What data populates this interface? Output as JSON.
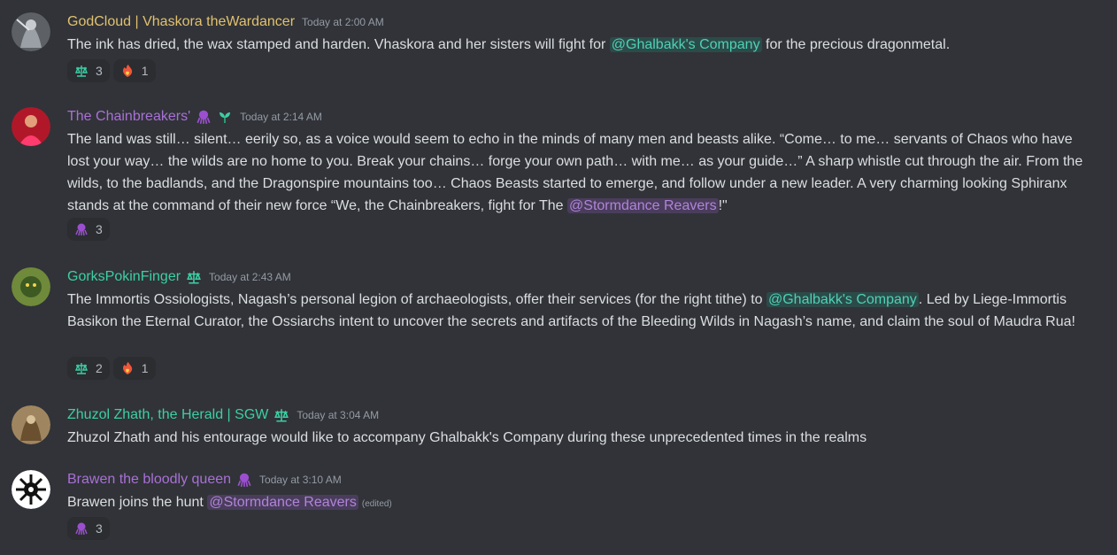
{
  "colors": {
    "background": "#313338",
    "gold": "#e1c16e",
    "purple": "#a970d6",
    "teal": "#3ccfa5"
  },
  "messages": [
    {
      "author": "GodCloud | Vhaskora theWardancer",
      "timestamp": "Today at 2:00 AM",
      "text_before": "The ink has dried, the wax stamped and harden. Vhaskora and her sisters will fight for ",
      "mention": "@Ghalbakk's Company",
      "text_after": " for the precious dragonmetal.",
      "reactions": [
        {
          "emoji": "scale-icon",
          "count": "3"
        },
        {
          "emoji": "fire-heart-icon",
          "count": "1"
        }
      ]
    },
    {
      "author": "The Chainbreakers'",
      "timestamp": "Today at 2:14 AM",
      "text_before": "The land was still… silent… eerily so, as a voice would seem to echo in the minds of many men and beasts alike. “Come… to me… servants of Chaos who have lost your way… the wilds are no home to you. Break your chains… forge your own path… with me… as your guide…” A sharp whistle cut through the air. From the wilds, to the badlands, and the Dragonspire mountains too… Chaos Beasts started to emerge, and follow under a new leader. A very charming looking Sphiranx stands at the command of their new force “We, the Chainbreakers, fight for The ",
      "mention": "@Stormdance Reavers",
      "text_after": "!\"",
      "reactions": [
        {
          "emoji": "octopus-icon",
          "count": "3"
        }
      ]
    },
    {
      "author": "GorksPokinFinger",
      "timestamp": "Today at 2:43 AM",
      "text_before": "The Immortis Ossiologists, Nagash’s personal legion of archaeologists, offer their services (for the right tithe) to ",
      "mention": "@Ghalbakk's Company",
      "text_after": ". Led by Liege-Immortis Basikon the Eternal Curator, the Ossiarchs intent to uncover the secrets and artifacts of the Bleeding Wilds in Nagash’s name, and claim the soul of Maudra Rua!",
      "reactions": [
        {
          "emoji": "scale-icon",
          "count": "2"
        },
        {
          "emoji": "fire-heart-icon",
          "count": "1"
        }
      ]
    },
    {
      "author": "Zhuzol Zhath, the Herald | SGW",
      "timestamp": "Today at 3:04 AM",
      "text_before": "Zhuzol Zhath and his entourage would like to accompany Ghalbakk's Company during these unprecedented times in the realms",
      "mention": "",
      "text_after": "",
      "reactions": []
    },
    {
      "author": "Brawen the bloodly queen",
      "timestamp": "Today at 3:10 AM",
      "text_before": "Brawen  joins the hunt ",
      "mention": "@Stormdance Reavers",
      "text_after": "",
      "edited": "(edited)",
      "reactions": [
        {
          "emoji": "octopus-icon",
          "count": "3"
        }
      ]
    }
  ]
}
